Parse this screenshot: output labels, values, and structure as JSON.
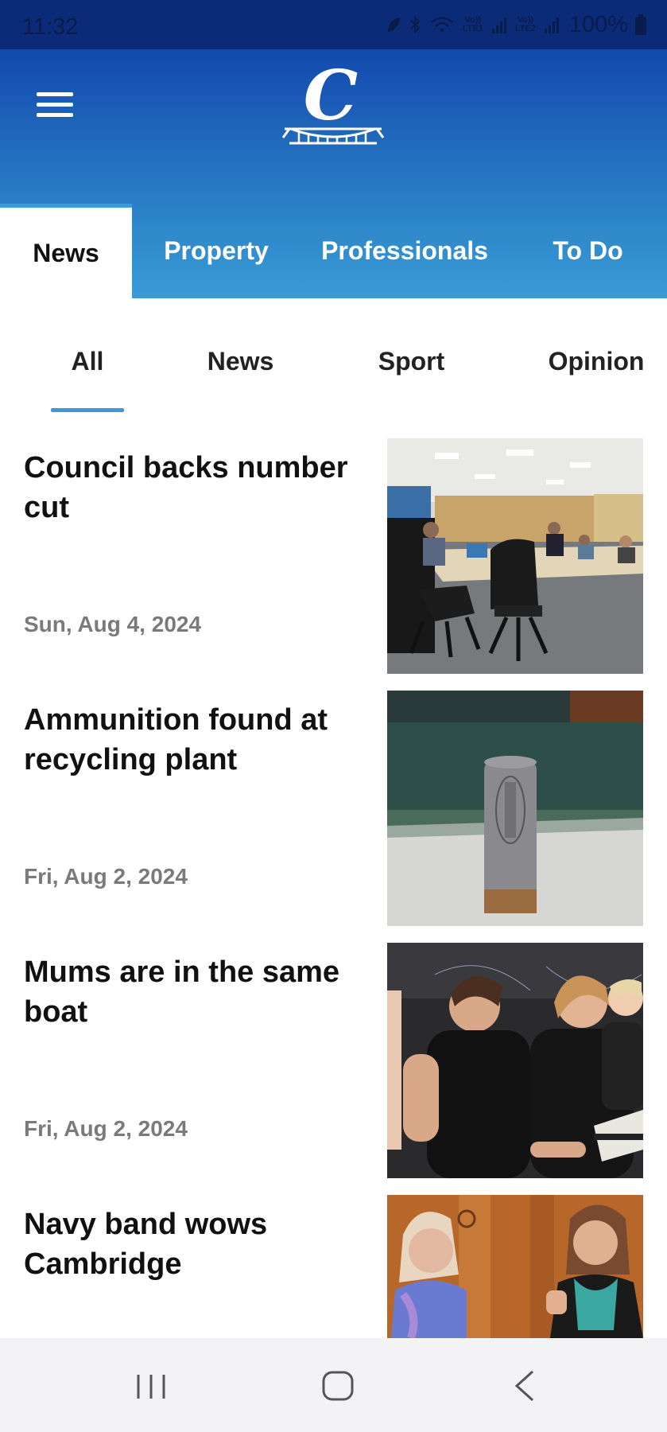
{
  "status_bar": {
    "time": "11:32",
    "lte1": "Vo)) LTE1",
    "lte2": "Vo)) LTE2",
    "battery": "100%"
  },
  "header": {
    "logo_letter": "C"
  },
  "main_tabs": [
    {
      "label": "News",
      "active": true
    },
    {
      "label": "Property",
      "active": false
    },
    {
      "label": "Professionals",
      "active": false
    },
    {
      "label": "To Do",
      "active": false
    }
  ],
  "sub_tabs": [
    {
      "label": "All",
      "active": true
    },
    {
      "label": "News",
      "active": false
    },
    {
      "label": "Sport",
      "active": false
    },
    {
      "label": "Opinion",
      "active": false
    }
  ],
  "articles": [
    {
      "title": "Council backs number cut",
      "date": "Sun, Aug 4, 2024",
      "image": "council-meeting-room"
    },
    {
      "title": "Ammunition found at recycling plant",
      "date": "Fri, Aug 2, 2024",
      "image": "shotgun-shell"
    },
    {
      "title": "Mums are in the same boat",
      "date": "Fri, Aug 2, 2024",
      "image": "rowing-mums"
    },
    {
      "title": "Navy band wows Cambridge",
      "date": "",
      "image": "two-women-smiling"
    }
  ],
  "colors": {
    "header_top": "#0d3e9c",
    "header_bottom": "#3a9ad6",
    "accent": "#3c9ad8"
  }
}
